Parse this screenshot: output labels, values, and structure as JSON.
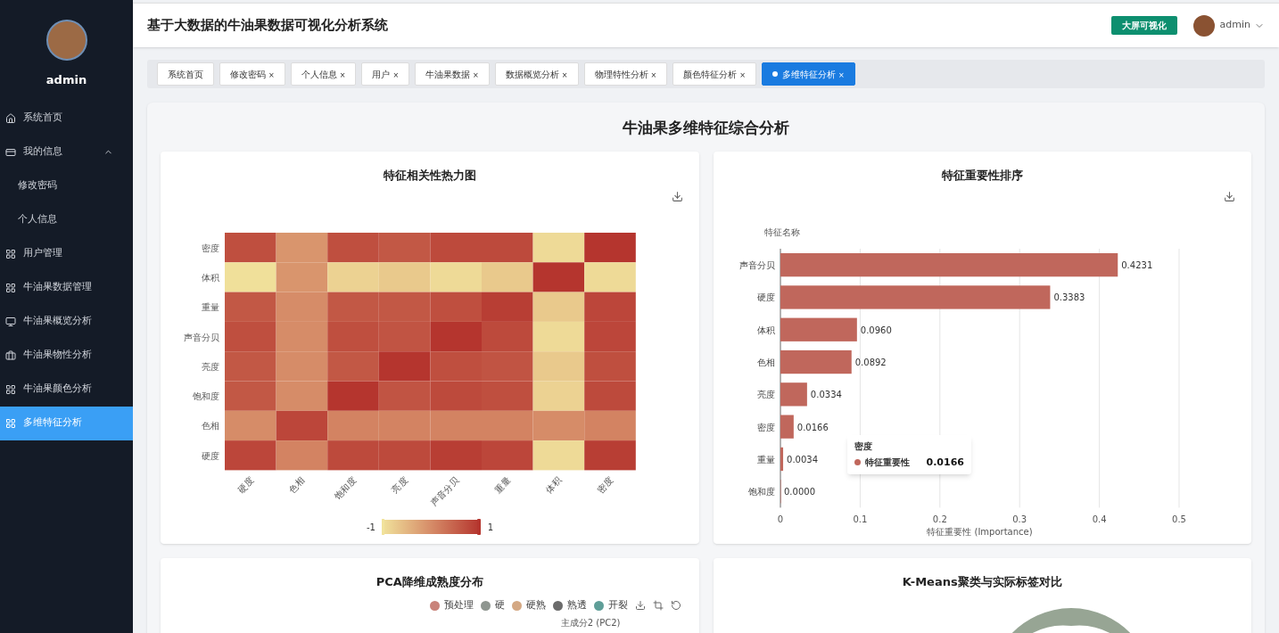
{
  "header": {
    "title": "基于大数据的牛油果数据可视化分析系统",
    "screen_button": "大屏可视化",
    "user": "admin"
  },
  "sidebar": {
    "user": "admin",
    "items": [
      {
        "label": "系统首页",
        "selected": false
      },
      {
        "label": "我的信息",
        "selected": false,
        "expanded": true,
        "children": [
          {
            "label": "修改密码",
            "selected": false
          },
          {
            "label": "个人信息",
            "selected": false
          }
        ]
      },
      {
        "label": "用户管理",
        "selected": false
      },
      {
        "label": "牛油果数据管理",
        "selected": false
      },
      {
        "label": "牛油果概览分析",
        "selected": false
      },
      {
        "label": "牛油果物性分析",
        "selected": false
      },
      {
        "label": "牛油果颜色分析",
        "selected": false
      },
      {
        "label": "多维特征分析",
        "selected": true
      }
    ]
  },
  "tabs": [
    {
      "label": "系统首页",
      "closable": false,
      "selected": false
    },
    {
      "label": "修改密码",
      "closable": true,
      "selected": false
    },
    {
      "label": "个人信息",
      "closable": true,
      "selected": false
    },
    {
      "label": "用户",
      "closable": true,
      "selected": false
    },
    {
      "label": "牛油果数据",
      "closable": true,
      "selected": false
    },
    {
      "label": "数据概览分析",
      "closable": true,
      "selected": false
    },
    {
      "label": "物理特性分析",
      "closable": true,
      "selected": false
    },
    {
      "label": "颜色特征分析",
      "closable": true,
      "selected": false
    },
    {
      "label": "多维特征分析",
      "closable": true,
      "selected": true
    }
  ],
  "close_glyph": "×",
  "page_title": "牛油果多维特征综合分析",
  "heatmap": {
    "title": "特征相关性热力图",
    "y_labels": [
      "密度",
      "体积",
      "重量",
      "声音分贝",
      "亮度",
      "饱和度",
      "色相",
      "硬度"
    ],
    "x_labels": [
      "硬度",
      "色相",
      "饱和度",
      "亮度",
      "声音分贝",
      "重量",
      "体积",
      "密度"
    ],
    "scale_min": "-1",
    "scale_max": "1"
  },
  "importance": {
    "title": "特征重要性排序",
    "chart_data": {
      "type": "bar",
      "orientation": "horizontal",
      "ylabel": "特征名称",
      "xlabel": "特征重要性 (Importance)",
      "categories": [
        "声音分贝",
        "硬度",
        "体积",
        "色相",
        "亮度",
        "密度",
        "重量",
        "饱和度"
      ],
      "series": [
        {
          "name": "特征重要性",
          "color": "#c0675c",
          "values": [
            0.4231,
            0.3383,
            0.096,
            0.0892,
            0.0334,
            0.0166,
            0.0034,
            0.0
          ]
        }
      ],
      "value_labels": [
        "0.4231",
        "0.3383",
        "0.0960",
        "0.0892",
        "0.0334",
        "0.0166",
        "0.0034",
        "0.0000"
      ],
      "xlim": [
        0,
        0.5
      ],
      "grid": true,
      "xticks": [
        {
          "value": 0,
          "label": "0"
        },
        {
          "value": 0.1,
          "label": "0.1"
        },
        {
          "value": 0.2,
          "label": "0.2"
        },
        {
          "value": 0.3,
          "label": "0.3"
        },
        {
          "value": 0.4,
          "label": "0.4"
        },
        {
          "value": 0.5,
          "label": "0.5"
        }
      ]
    },
    "tooltip": {
      "title": "密度",
      "value": "0.0166"
    }
  },
  "pca": {
    "title": "PCA降维成熟度分布",
    "legend": [
      {
        "label": "预处理",
        "color": "#c9837a"
      },
      {
        "label": "硬",
        "color": "#8f9690"
      },
      {
        "label": "硬熟",
        "color": "#d4a883"
      },
      {
        "label": "熟透",
        "color": "#6b6b6b"
      },
      {
        "label": "开裂",
        "color": "#5f9e98"
      }
    ],
    "axis_label": "主成分2 (PC2)"
  },
  "kmeans": {
    "title": "K-Means聚类与实际标签对比"
  }
}
